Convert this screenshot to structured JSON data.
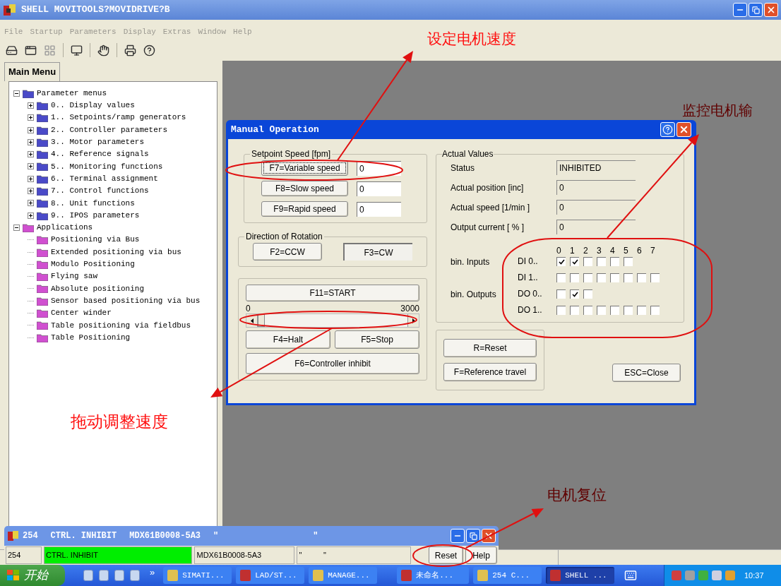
{
  "window": {
    "title": "SHELL MOVITOOLS?MOVIDRIVE?B"
  },
  "menu": [
    "File",
    "Startup",
    "Parameters",
    "Display",
    "Extras",
    "Window",
    "Help"
  ],
  "main_menu": {
    "tab": "Main Menu",
    "tree": [
      {
        "label": "Parameter menus",
        "expanded": true,
        "color": "#4a4ac8",
        "children": [
          {
            "label": "0.. Display values",
            "expanded": false
          },
          {
            "label": "1.. Setpoints/ramp generators",
            "expanded": false
          },
          {
            "label": "2.. Controller parameters",
            "expanded": false
          },
          {
            "label": "3.. Motor parameters",
            "expanded": false
          },
          {
            "label": "4.. Reference signals",
            "expanded": false
          },
          {
            "label": "5.. Monitoring functions",
            "expanded": false
          },
          {
            "label": "6.. Terminal assignment",
            "expanded": false
          },
          {
            "label": "7.. Control functions",
            "expanded": false
          },
          {
            "label": "8.. Unit functions",
            "expanded": false
          },
          {
            "label": "9.. IPOS parameters",
            "expanded": false
          }
        ]
      },
      {
        "label": "Applications",
        "expanded": true,
        "color": "#d050d0",
        "children": [
          {
            "label": "Positioning via Bus"
          },
          {
            "label": "Extended positioning via bus"
          },
          {
            "label": "Modulo Positioning"
          },
          {
            "label": "Flying saw"
          },
          {
            "label": "Absolute positioning"
          },
          {
            "label": "Sensor based positioning via bus"
          },
          {
            "label": "Center winder"
          },
          {
            "label": "Table positioning via fieldbus"
          },
          {
            "label": "Table Positioning"
          }
        ]
      }
    ]
  },
  "dialog": {
    "title": "Manual Operation",
    "setpoint": {
      "legend": "Setpoint Speed [fpm]",
      "rows": [
        {
          "button": "F7=Variable speed",
          "value": "0",
          "focused": true
        },
        {
          "button": "F8=Slow speed",
          "value": "0",
          "focused": false
        },
        {
          "button": "F9=Rapid speed",
          "value": "0",
          "focused": false
        }
      ]
    },
    "direction": {
      "legend": "Direction of Rotation",
      "buttons": [
        {
          "label": "F2=CCW",
          "selected": false
        },
        {
          "label": "F3=CW",
          "selected": true
        }
      ]
    },
    "start": "F11=START",
    "slider": {
      "min": "0",
      "max": "3000",
      "level": 0
    },
    "halt": "F4=Halt",
    "stop": "F5=Stop",
    "inhibit": "F6=Controller inhibit",
    "actual": {
      "legend": "Actual Values",
      "rows": [
        {
          "label": "Status",
          "value": "INHIBITED"
        },
        {
          "label": "Actual position [inc]",
          "value": "0"
        },
        {
          "label": "Actual speed [1/min ]",
          "value": "0"
        },
        {
          "label": "Output current [ % ]",
          "value": "0"
        }
      ]
    },
    "binary": {
      "columns": [
        "0",
        "1",
        "2",
        "3",
        "4",
        "5",
        "6",
        "7"
      ],
      "groups": [
        {
          "label": "bin. Inputs",
          "rows": [
            {
              "label": "DI 0..",
              "bits": [
                {
                  "checked": true
                },
                {
                  "checked": true
                },
                {
                  "checked": false
                },
                {
                  "checked": false
                },
                {
                  "checked": false
                },
                {
                  "checked": false
                }
              ]
            },
            {
              "label": "DI 1..",
              "bits": [
                {
                  "checked": false
                },
                {
                  "checked": false
                },
                {
                  "checked": false
                },
                {
                  "checked": false
                },
                {
                  "checked": false
                },
                {
                  "checked": false
                },
                {
                  "checked": false
                },
                {
                  "checked": false
                }
              ]
            }
          ]
        },
        {
          "label": "bin. Outputs",
          "rows": [
            {
              "label": "DO 0..",
              "bits": [
                {
                  "checked": false
                },
                {
                  "checked": true
                },
                {
                  "checked": false
                }
              ]
            },
            {
              "label": "DO 1..",
              "bits": [
                {
                  "checked": false
                },
                {
                  "checked": false
                },
                {
                  "checked": false
                },
                {
                  "checked": false
                },
                {
                  "checked": false
                },
                {
                  "checked": false
                },
                {
                  "checked": false
                },
                {
                  "checked": false
                }
              ]
            }
          ]
        }
      ]
    },
    "reset": "R=Reset",
    "reference": "F=Reference travel",
    "close": "ESC=Close"
  },
  "status_window": {
    "title_parts": [
      "254",
      "CTRL. INHIBIT",
      "MDX61B0008-5A3",
      "\"",
      "\""
    ],
    "fields": [
      {
        "value": "254"
      },
      {
        "value": "CTRL. INHIBIT",
        "color": "#00ee00"
      },
      {
        "value": "MDX61B0008-5A3"
      },
      {
        "value": "\"          \""
      }
    ],
    "buttons": [
      "Reset",
      "Help"
    ]
  },
  "annotations": [
    "设定电机速度",
    "监控电机输",
    "拖动调整速度",
    "电机复位"
  ],
  "taskbar": {
    "start": "开始",
    "overflow": "»",
    "tasks": [
      {
        "label": "SIMATI...",
        "selected": false
      },
      {
        "label": "LAD/ST...",
        "selected": false
      },
      {
        "label": "MANAGE...",
        "selected": false
      },
      {
        "label": "未命名...",
        "selected": false
      },
      {
        "label": "254  C...",
        "selected": false
      },
      {
        "label": "SHELL ...",
        "selected": true
      }
    ],
    "clock": "10:37"
  }
}
